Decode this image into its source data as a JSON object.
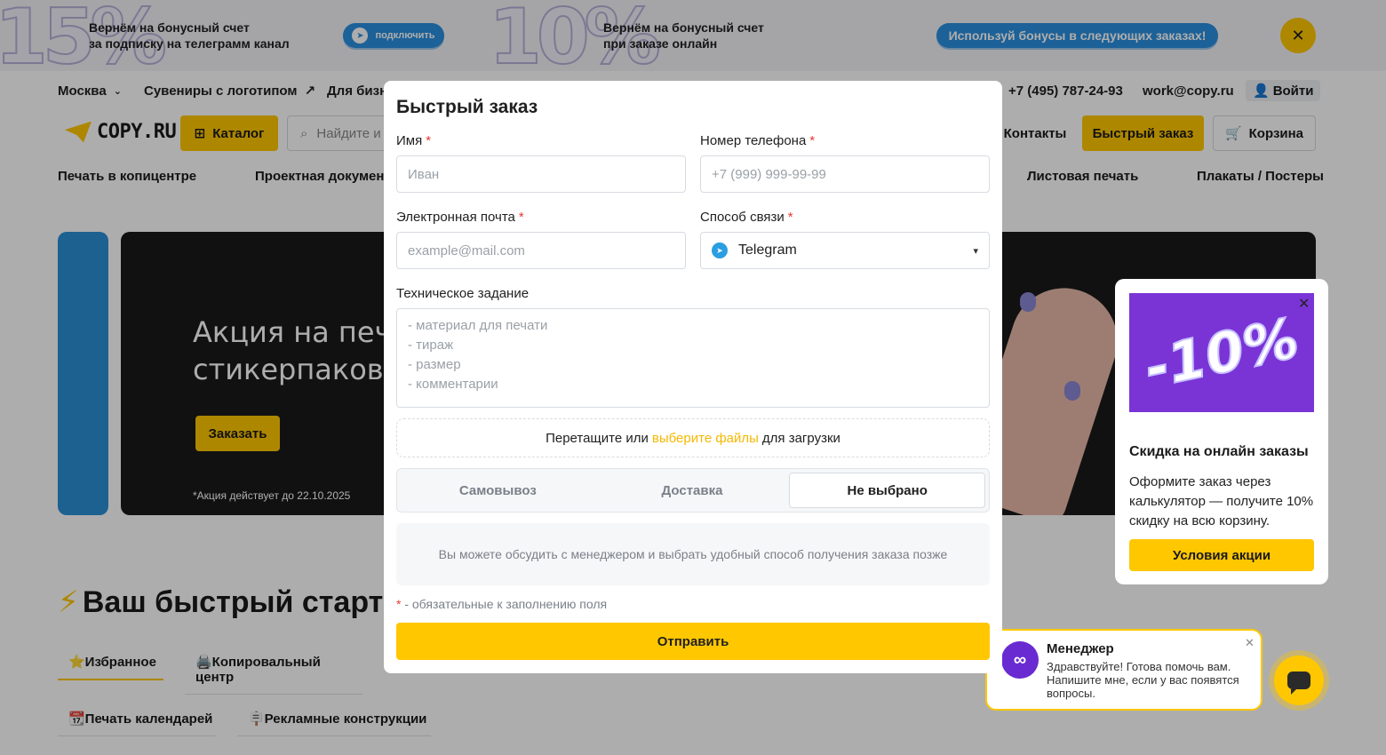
{
  "promo": {
    "big1": "15%",
    "text1_line1": "Вернём на бонусный счет",
    "text1_line2": "за подписку на телеграмм канал",
    "connect_label": "подключить",
    "big2": "10%",
    "text2_line1": "Вернём на бонусный счет",
    "text2_line2": "при заказе онлайн",
    "bonus_label": "Используй бонусы в следующих заказах!",
    "close_icon": "close-icon"
  },
  "topnav": {
    "city": "Москва",
    "souvenirs": "Сувениры с логотипом",
    "business": "Для бизн",
    "phone": "+7 (495) 787-24-93",
    "email": "work@copy.ru",
    "login": "Войти"
  },
  "header": {
    "logo": "COPY.RU",
    "catalog": "Каталог",
    "search_placeholder": "Найдите и",
    "contacts": "Контакты",
    "quick_order": "Быстрый заказ",
    "cart": "Корзина"
  },
  "catnav": {
    "item1": "Печать в копицентре",
    "item2": "Проектная документ",
    "item3": "Листовая печать",
    "item4": "Плакаты / Постеры"
  },
  "hero": {
    "title_line1": "Акция на печа",
    "title_line2": "стикерпаков!",
    "button": "Заказать",
    "note": "*Акция действует до 22.10.2025"
  },
  "quickstart": {
    "title": "Ваш быстрый старт",
    "tabs": [
      "⭐Избранное",
      "🖨️Копировальный центр",
      "📆Печать календарей",
      "🪧Рекламные конструкции"
    ]
  },
  "side_promo": {
    "image_text": "-10%",
    "title": "Скидка на онлайн заказы",
    "text": "Оформите заказ через калькулятор — получите 10% скидку на всю корзину.",
    "button": "Условия акции"
  },
  "chat": {
    "name": "Менеджер",
    "message": "Здравствуйте! Готова помочь вам. Напишите мне, если у вас появятся вопросы."
  },
  "modal": {
    "title": "Быстрый заказ",
    "name_label": "Имя",
    "name_placeholder": "Иван",
    "phone_label": "Номер телефона",
    "phone_placeholder": "+7 (999) 999-99-99",
    "email_label": "Электронная почта",
    "email_placeholder": "example@mail.com",
    "contact_label": "Способ связи",
    "contact_value": "Telegram",
    "tz_label": "Техническое задание",
    "tz_placeholder": "- материал для печати\n- тираж\n- размер\n- комментарии",
    "drop_text_before": "Перетащите или",
    "drop_link": "выберите файлы",
    "drop_text_after": "для загрузки",
    "delivery_options": [
      "Самовывоз",
      "Доставка",
      "Не выбрано"
    ],
    "delivery_selected": "Не выбрано",
    "info_text": "Вы можете обсудить с менеджером и выбрать удобный способ получения заказа позже",
    "required_star": "*",
    "required_note": " - обязательные к заполнению поля",
    "submit": "Отправить"
  },
  "colors": {
    "accent": "#ffc700",
    "required": "#e53935",
    "telegram": "#2a9ee0",
    "promo_purple": "#7a34d6"
  }
}
